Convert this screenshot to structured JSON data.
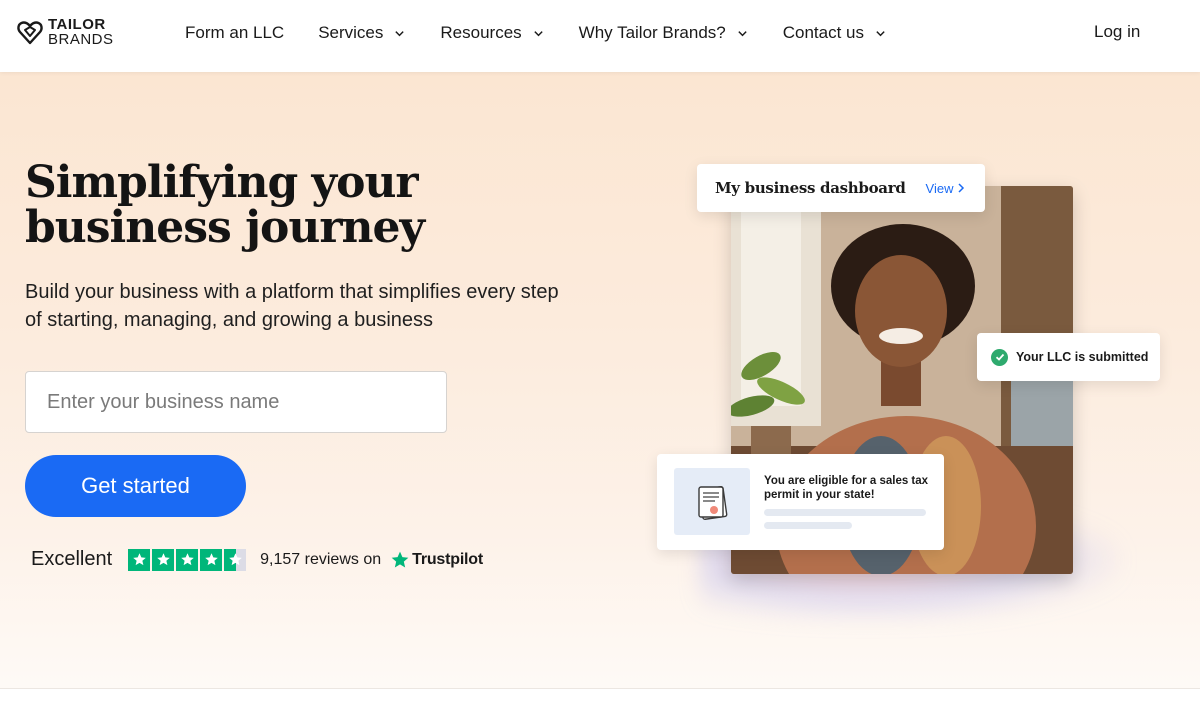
{
  "brand": {
    "line1": "TAILOR",
    "line2": "BRANDS"
  },
  "nav": {
    "items": [
      {
        "label": "Form an LLC",
        "dropdown": false
      },
      {
        "label": "Services",
        "dropdown": true
      },
      {
        "label": "Resources",
        "dropdown": true
      },
      {
        "label": "Why Tailor Brands?",
        "dropdown": true
      },
      {
        "label": "Contact us",
        "dropdown": true
      }
    ],
    "login": "Log in"
  },
  "hero": {
    "headline_line1": "Simplifying your",
    "headline_line2": "business journey",
    "subtext_line1": "Build your business with a platform that simplifies every step",
    "subtext_line2": "of starting, managing, and growing a business",
    "input_placeholder": "Enter your business name",
    "cta_label": "Get started"
  },
  "rating": {
    "label": "Excellent",
    "stars": 4.5,
    "reviews_text": "9,157 reviews on",
    "provider": "Trustpilot"
  },
  "visual": {
    "dashboard_title": "My business dashboard",
    "dashboard_link": "View",
    "llc_status": "Your LLC is submitted",
    "tax_message": "You are eligible for a sales tax permit in your state!"
  },
  "colors": {
    "accent": "#1a6af4",
    "trustpilot_green": "#00b67a",
    "success": "#2eaa6e",
    "hero_bg": "#fbe6d2"
  }
}
